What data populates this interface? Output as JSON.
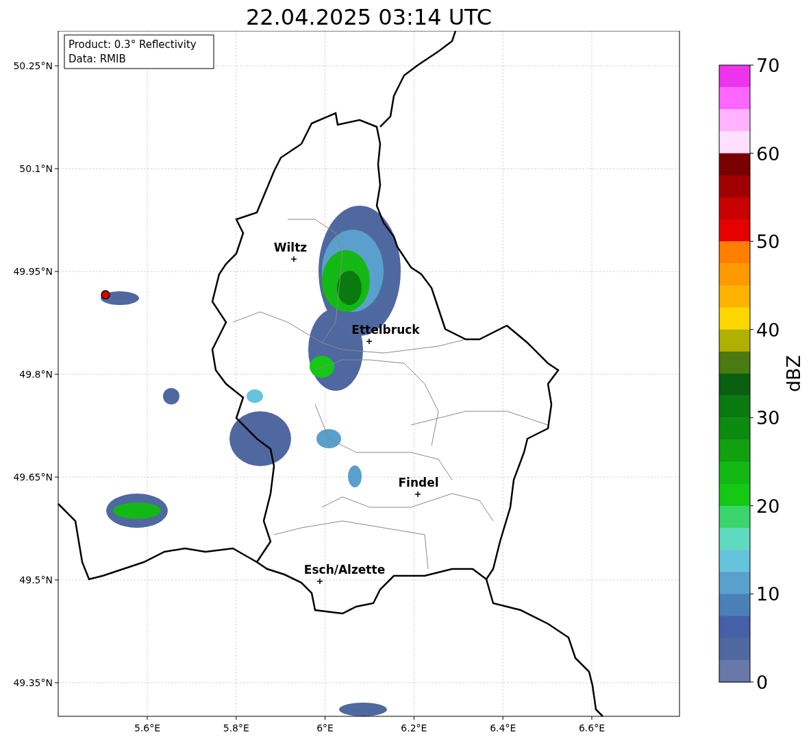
{
  "title": "22.04.2025 03:14 UTC",
  "info_box": [
    "Product: 0.3° Reflectivity",
    "Data: RMIB"
  ],
  "map": {
    "lon_ticks": [
      "5.6°E",
      "5.8°E",
      "6°E",
      "6.2°E",
      "6.4°E",
      "6.6°E"
    ],
    "lat_ticks": [
      "50.25°N",
      "50.1°N",
      "49.95°N",
      "49.8°N",
      "49.65°N",
      "49.5°N",
      "49.35°N"
    ],
    "cities": [
      {
        "name": "Wiltz"
      },
      {
        "name": "Ettelbruck"
      },
      {
        "name": "Findel"
      },
      {
        "name": "Esch/Alzette"
      }
    ]
  },
  "colorbar": {
    "label": "dBZ",
    "ticks": [
      "70",
      "60",
      "50",
      "40",
      "30",
      "20",
      "10",
      "0"
    ],
    "segments": [
      {
        "color": "#ee33ee"
      },
      {
        "color": "#ff66ff"
      },
      {
        "color": "#ffb3ff"
      },
      {
        "color": "#ffe0ff"
      },
      {
        "color": "#780000"
      },
      {
        "color": "#a00000"
      },
      {
        "color": "#c80000"
      },
      {
        "color": "#e60000"
      },
      {
        "color": "#ff7f00"
      },
      {
        "color": "#ff9900"
      },
      {
        "color": "#ffb300"
      },
      {
        "color": "#ffd700"
      },
      {
        "color": "#b0b000"
      },
      {
        "color": "#4a7a10"
      },
      {
        "color": "#0a6010"
      },
      {
        "color": "#0a7a10"
      },
      {
        "color": "#0c8a10"
      },
      {
        "color": "#10a010"
      },
      {
        "color": "#14b814"
      },
      {
        "color": "#14c814"
      },
      {
        "color": "#3cd46c"
      },
      {
        "color": "#5fd9c0"
      },
      {
        "color": "#66c3dc"
      },
      {
        "color": "#5aa0cc"
      },
      {
        "color": "#4a80b8"
      },
      {
        "color": "#4660a8"
      },
      {
        "color": "#5068a0"
      },
      {
        "color": "#6878a8"
      }
    ]
  }
}
